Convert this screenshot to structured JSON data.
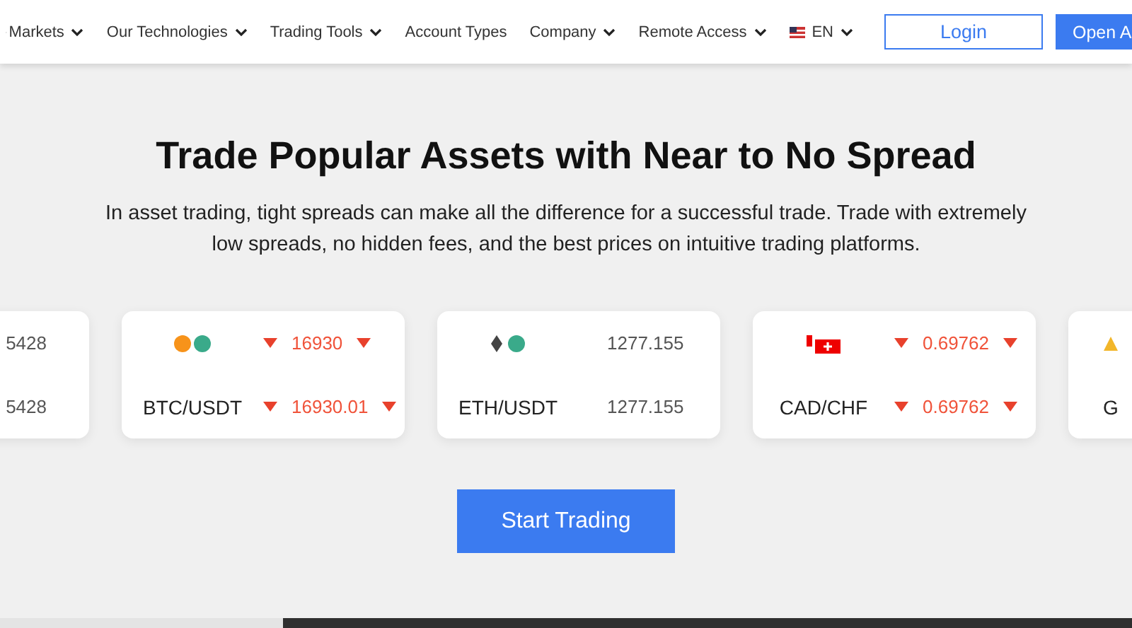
{
  "nav": {
    "items": [
      {
        "label": "Markets",
        "dropdown": true
      },
      {
        "label": "Our Technologies",
        "dropdown": true
      },
      {
        "label": "Trading Tools",
        "dropdown": true
      },
      {
        "label": "Account Types",
        "dropdown": false
      },
      {
        "label": "Company",
        "dropdown": true
      },
      {
        "label": "Remote Access",
        "dropdown": true
      }
    ],
    "language": "EN",
    "login": "Login",
    "open": "Open A"
  },
  "hero": {
    "title": "Trade Popular Assets with Near to No Spread",
    "text": "In asset trading, tight spreads can make all the difference for a successful trade. Trade with extremely low spreads, no hidden fees, and the best prices on intuitive trading platforms."
  },
  "tickers": [
    {
      "kind": "partial",
      "bid": "5428",
      "ask": "5428",
      "falling": false
    },
    {
      "kind": "crypto",
      "pair": "BTC/USDT",
      "bid": "16930",
      "ask": "16930.01",
      "falling": true
    },
    {
      "kind": "crypto",
      "pair": "ETH/USDT",
      "bid": "1277.155",
      "ask": "1277.155",
      "falling": false
    },
    {
      "kind": "forex",
      "pair": "CAD/CHF",
      "bid": "0.69762",
      "ask": "0.69762",
      "falling": true
    },
    {
      "kind": "partial",
      "pair": "G"
    }
  ],
  "cta": "Start Trading"
}
